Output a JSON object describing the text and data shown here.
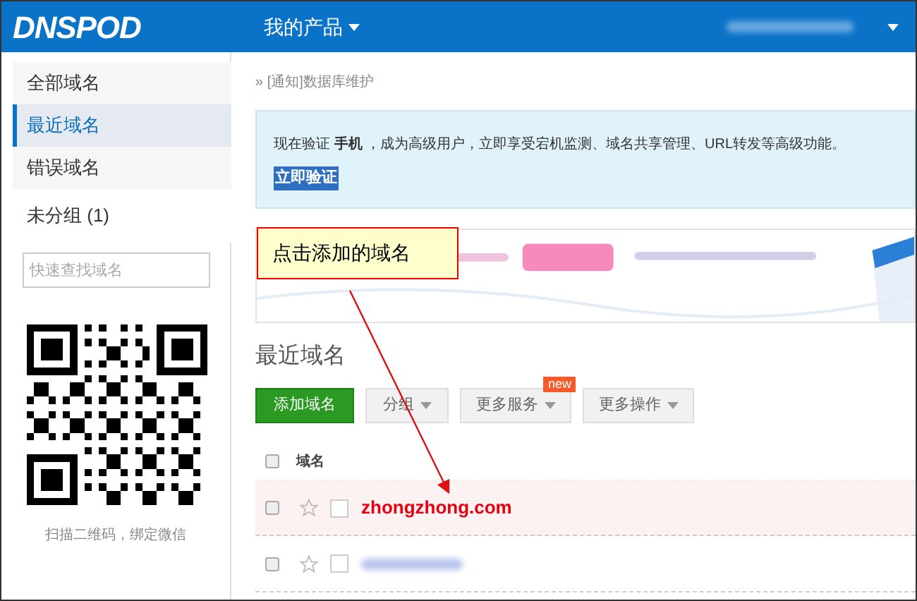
{
  "header": {
    "logo": "DNSPOD",
    "menu": "我的产品"
  },
  "sidebar": {
    "items": [
      {
        "label": "全部域名",
        "selected": false
      },
      {
        "label": "最近域名",
        "selected": true
      },
      {
        "label": "错误域名",
        "selected": false
      },
      {
        "label": "未分组 (1)",
        "selected": false
      }
    ],
    "search": {
      "placeholder": "快速查找域名"
    },
    "qr_caption": "扫描二维码，绑定微信"
  },
  "breadcrumb": "» [通知]数据库维护",
  "notice": {
    "text": "现在验证 **手机** ，成为高级用户，立即享受宕机监测、域名共享管理、URL转发等高级功能。",
    "link": "立即验证"
  },
  "section_title": "最近域名",
  "toolbar": [
    {
      "label": "添加域名",
      "kind": "primary"
    },
    {
      "label": "分组",
      "kind": "dropdown"
    },
    {
      "label": "更多服务",
      "kind": "dropdown",
      "badge": "new"
    },
    {
      "label": "更多操作",
      "kind": "dropdown"
    }
  ],
  "table": {
    "select_all": {
      "checked": false
    },
    "columns": [
      "域名"
    ],
    "rows": [
      {
        "domain": "zhongzhong.com",
        "highlighted": true,
        "checked": false
      },
      {
        "highlighted": false,
        "checked": false
      }
    ]
  },
  "callout": "点击添加的域名"
}
